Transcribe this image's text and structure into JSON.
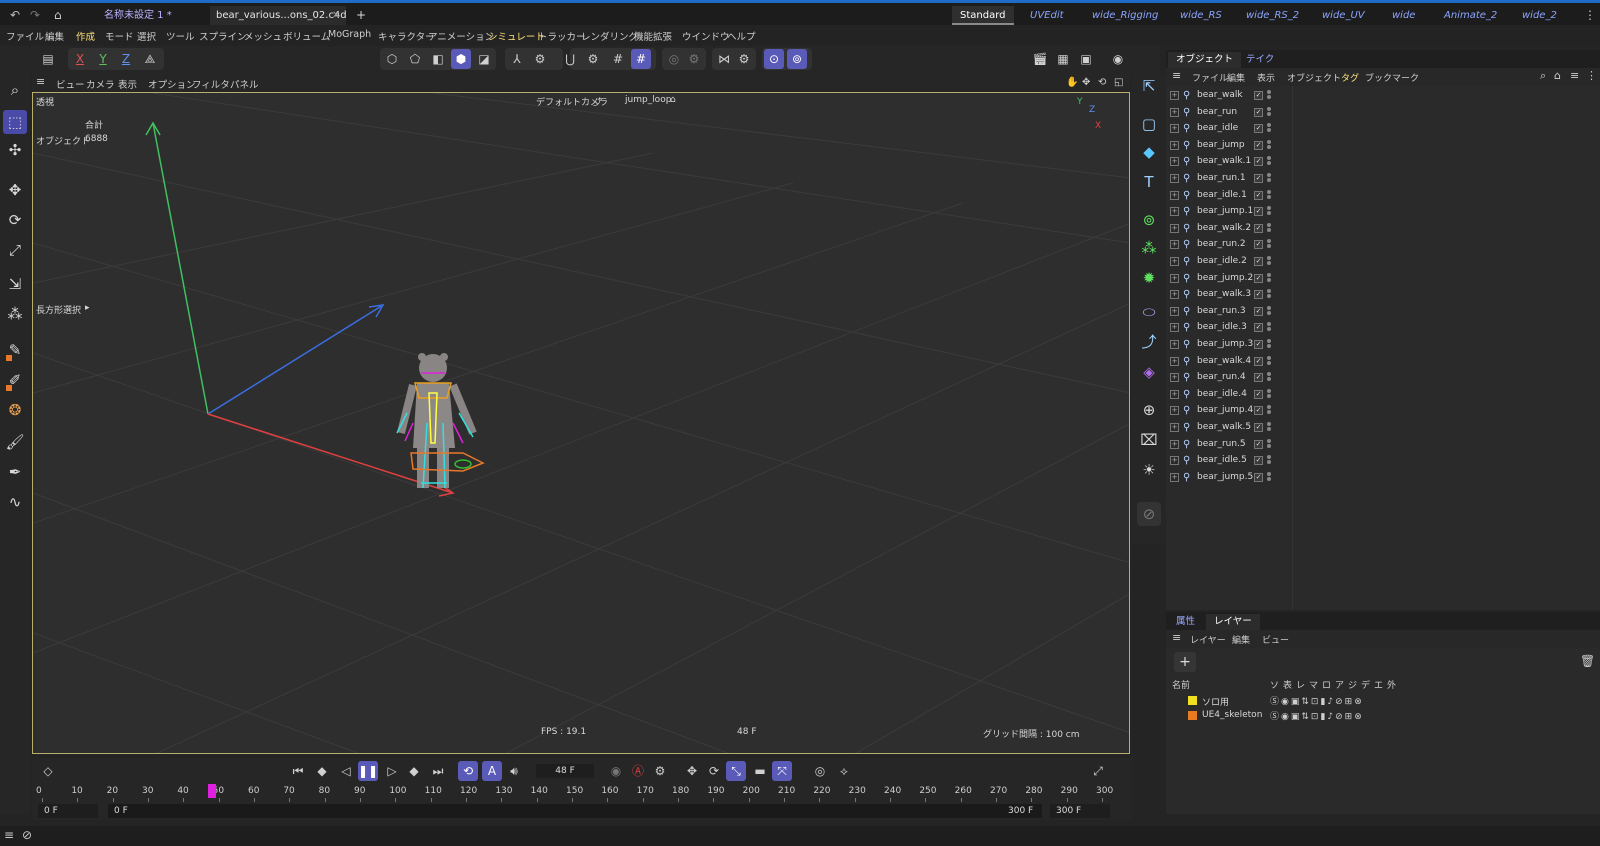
{
  "tabs": {
    "doc_tabs": [
      {
        "label": "名称未設定 1 *",
        "active": false
      },
      {
        "label": "bear_various...ons_02.c4d *",
        "active": true
      }
    ],
    "new_tab_symbol": "+",
    "layouts": [
      "Standard",
      "UVEdit",
      "wide_Rigging",
      "wide_RS",
      "wide_RS_2",
      "wide_UV",
      "wide",
      "Animate_2",
      "wide_2"
    ],
    "active_layout": "Standard"
  },
  "menubar": {
    "items": [
      "ファイル",
      "編集",
      "作成",
      "モード",
      "選択",
      "ツール",
      "スプライン",
      "メッシュ",
      "ボリューム",
      "MoGraph",
      "キャラクター",
      "アニメーション",
      "シミュレート",
      "トラッカー",
      "レンダリング",
      "機能拡張",
      "ウインドウ",
      "ヘルプ"
    ]
  },
  "toolbar": {
    "axis_x": "X",
    "axis_y": "Y",
    "axis_z": "Z"
  },
  "viewport": {
    "menu": [
      "ビュー",
      "カメラ",
      "表示",
      "オプション",
      "フィルタ",
      "パネル"
    ],
    "projection": "透視",
    "camera_label": "デフォルトカメラ",
    "take_label": "jump_loop",
    "stats_header": "合計",
    "stats_label": "オブジェクト",
    "stats_value": "6888",
    "selection_tool": "長方形選択",
    "fps": "FPS : 19.1",
    "frame": "48 F",
    "grid_spacing": "グリッド間隔 : 100 cm",
    "colors": {
      "x_axis": "#e04040",
      "y_axis": "#40c060",
      "z_axis": "#3a6ee0",
      "frame_border": "#b8b068"
    }
  },
  "object_manager": {
    "tabs": [
      "オブジェクト",
      "テイク"
    ],
    "active_tab": "オブジェクト",
    "menu": [
      "ファイル",
      "編集",
      "表示",
      "オブジェクト",
      "タグ",
      "ブックマーク"
    ],
    "objects": [
      "bear_walk",
      "bear_run",
      "bear_idle",
      "bear_jump",
      "bear_walk.1",
      "bear_run.1",
      "bear_idle.1",
      "bear_jump.1",
      "bear_walk.2",
      "bear_run.2",
      "bear_idle.2",
      "bear_jump.2",
      "bear_walk.3",
      "bear_run.3",
      "bear_idle.3",
      "bear_jump.3",
      "bear_walk.4",
      "bear_run.4",
      "bear_idle.4",
      "bear_jump.4",
      "bear_walk.5",
      "bear_run.5",
      "bear_idle.5",
      "bear_jump.5"
    ]
  },
  "attributes": {
    "tabs": [
      "属性",
      "レイヤー"
    ],
    "active_tab": "レイヤー",
    "menu": [
      "レイヤー",
      "編集",
      "ビュー"
    ],
    "add_symbol": "+",
    "columns": {
      "name": "名前",
      "flags": [
        "ソ",
        "表",
        "レ",
        "マ",
        "ロ",
        "ア",
        "ジ",
        "デ",
        "エ",
        "外"
      ]
    },
    "layers": [
      {
        "name": "ソロ用",
        "color": "#f0e020"
      },
      {
        "name": "UE4_skeleton",
        "color": "#e87a20"
      }
    ]
  },
  "timeline": {
    "current_frame": "48 F",
    "playhead_frame": 48,
    "ticks": [
      0,
      10,
      20,
      30,
      40,
      50,
      60,
      70,
      80,
      90,
      100,
      110,
      120,
      130,
      140,
      150,
      160,
      170,
      180,
      190,
      200,
      210,
      220,
      230,
      240,
      250,
      260,
      270,
      280,
      290,
      300
    ],
    "range_start_outer": "0 F",
    "range_start": "0 F",
    "range_end": "300 F",
    "range_end_outer": "300 F",
    "playhead_color": "#e020e0"
  }
}
